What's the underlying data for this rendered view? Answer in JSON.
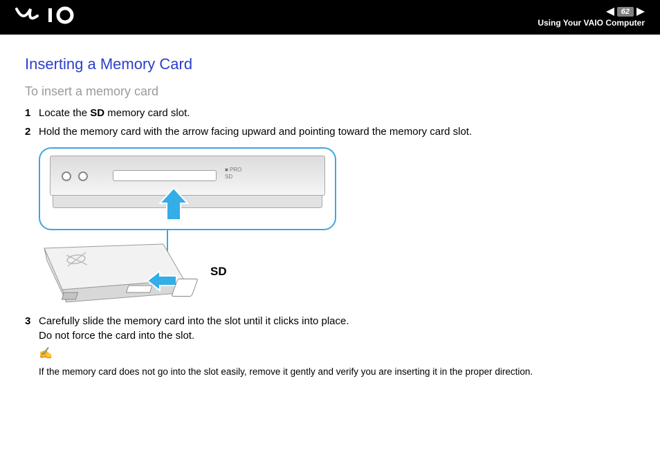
{
  "header": {
    "page_number": "62",
    "breadcrumb": "Using Your VAIO Computer"
  },
  "content": {
    "title": "Inserting a Memory Card",
    "subtitle": "To insert a memory card",
    "steps": {
      "s1": {
        "num": "1",
        "pre": "Locate the ",
        "bold": "SD",
        "post": " memory card slot."
      },
      "s2": {
        "num": "2",
        "text": "Hold the memory card with the arrow facing upward and pointing toward the memory card slot."
      },
      "s3": {
        "num": "3",
        "line1": "Carefully slide the memory card into the slot until it clicks into place.",
        "line2": "Do not force the card into the slot."
      }
    },
    "illustration": {
      "sd_label": "SD",
      "slot_label_pro": "■ PRO",
      "slot_label_sd": "SD"
    },
    "note": "If the memory card does not go into the slot easily, remove it gently and verify you are inserting it in the proper direction."
  }
}
